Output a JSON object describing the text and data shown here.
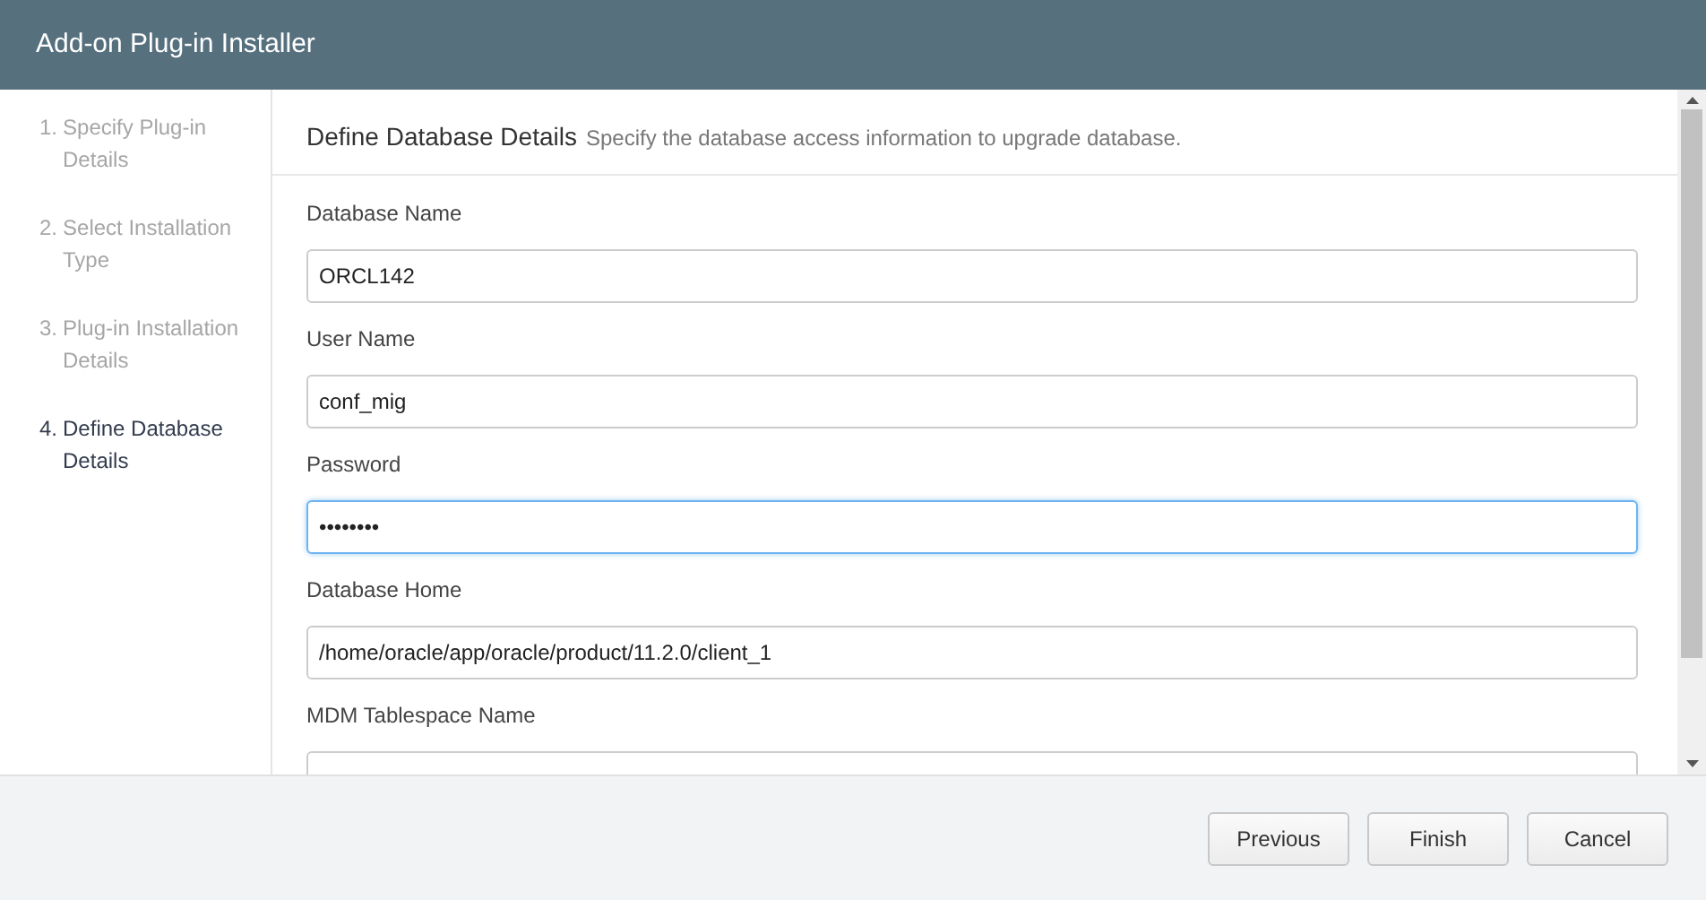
{
  "window": {
    "title": "Add-on Plug-in Installer"
  },
  "steps": [
    {
      "number": "1.",
      "label": "Specify Plug-in Details",
      "selected": false
    },
    {
      "number": "2.",
      "label": "Select Installation Type",
      "selected": false
    },
    {
      "number": "3.",
      "label": "Plug-in Installation Details",
      "selected": false
    },
    {
      "number": "4.",
      "label": "Define Database Details",
      "selected": true
    }
  ],
  "section": {
    "title": "Define Database Details",
    "description": "Specify the database access information to upgrade database."
  },
  "fields": [
    {
      "label": "Database Name",
      "value": "ORCL142",
      "focused": false
    },
    {
      "label": "User Name",
      "value": "conf_mig",
      "focused": false
    },
    {
      "label": "Password",
      "value": "••••••••",
      "focused": true
    },
    {
      "label": "Database Home",
      "value": "/home/oracle/app/oracle/product/11.2.0/client_1",
      "focused": false
    },
    {
      "label": "MDM Tablespace Name",
      "focused": false
    }
  ],
  "buttons": [
    "Previous",
    "Finish",
    "Cancel"
  ]
}
